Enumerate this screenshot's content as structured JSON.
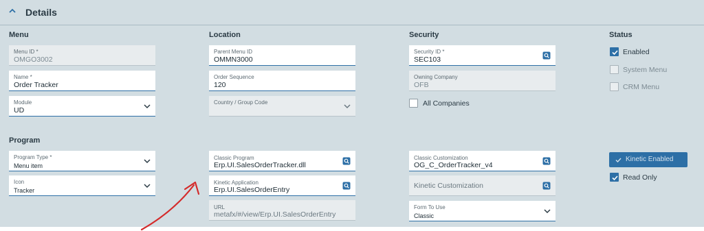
{
  "header": {
    "title": "Details"
  },
  "menu": {
    "section": "Menu",
    "menu_id": {
      "label": "Menu ID *",
      "value": "OMGO3002"
    },
    "name": {
      "label": "Name *",
      "value": "Order Tracker"
    },
    "module": {
      "label": "Module",
      "value": "UD"
    }
  },
  "location": {
    "section": "Location",
    "parent_menu_id": {
      "label": "Parent Menu ID",
      "value": "OMMN3000"
    },
    "order_sequence": {
      "label": "Order Sequence",
      "value": "120"
    },
    "country_group_code": {
      "label": "Country / Group Code",
      "value": ""
    }
  },
  "security": {
    "section": "Security",
    "security_id": {
      "label": "Security ID *",
      "value": "SEC103"
    },
    "owning_company": {
      "label": "Owning Company",
      "value": "OFB"
    },
    "all_companies": {
      "label": "All Companies",
      "checked": false
    }
  },
  "status": {
    "section": "Status",
    "enabled": {
      "label": "Enabled",
      "checked": true
    },
    "system_menu": {
      "label": "System Menu",
      "checked": false
    },
    "crm_menu": {
      "label": "CRM Menu",
      "checked": false
    }
  },
  "program": {
    "section": "Program",
    "program_type": {
      "label": "Program Type *",
      "value": "Menu item"
    },
    "icon": {
      "label": "Icon",
      "value": "Tracker"
    },
    "classic_program": {
      "label": "Classic Program",
      "value": "Erp.UI.SalesOrderTracker.dll"
    },
    "kinetic_application": {
      "label": "Kinetic Application",
      "value": "Erp.UI.SalesOrderEntry"
    },
    "url": {
      "label": "URL",
      "value": "metafx/#/view/Erp.UI.SalesOrderEntry"
    },
    "classic_customization": {
      "label": "Classic Customization",
      "value": "OG_C_OrderTracker_v4"
    },
    "kinetic_customization": {
      "placeholder": "Kinetic Customization"
    },
    "form_to_use": {
      "label": "Form To Use",
      "value": "Classic"
    },
    "kinetic_enabled": {
      "label": "Kinetic Enabled",
      "checked": true
    },
    "read_only": {
      "label": "Read Only",
      "checked": true
    }
  },
  "icons": {
    "collapse": "chevron-up-icon",
    "dropdown": "chevron-down-icon",
    "search": "search-icon",
    "check": "check-icon",
    "annotation": "red-arrow-annotation"
  },
  "colors": {
    "panel": "#d2dde2",
    "accent": "#2d6fa6",
    "annotation": "#d42a2a"
  }
}
